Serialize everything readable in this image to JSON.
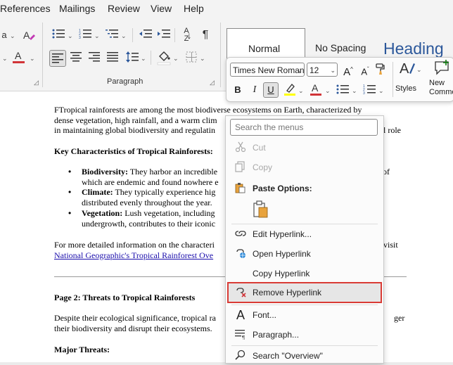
{
  "tabs": [
    "References",
    "Mailings",
    "Review",
    "View",
    "Help"
  ],
  "ribbon": {
    "paragraph_label": "Paragraph",
    "styles": [
      "Normal",
      "No Spacing",
      "Heading"
    ]
  },
  "mini_toolbar": {
    "font_name": "Times New Roman",
    "font_size": "12",
    "styles_label": "Styles",
    "new_comment_label": "New Comment",
    "bold": "B",
    "italic": "I",
    "underline": "U",
    "grow_font": "A",
    "shrink_font": "A"
  },
  "document": {
    "intro": [
      "FTropical rainforests are among the most biodiverse ecosystems on Earth, characterized by",
      "dense vegetation, high rainfall, and a warm clim",
      "in maintaining global biodiversity and regulatin"
    ],
    "intro_tail_1": "l role",
    "key_heading": "Key Characteristics of Tropical Rainforests:",
    "bullets": [
      {
        "title": "Biodiversity:",
        "line1": "They harbor an incredible",
        "line2": "which are endemic and found nowhere e",
        "tail": "of"
      },
      {
        "title": "Climate:",
        "line1": "They typically experience hig",
        "line2": "distributed evenly throughout the year.",
        "tail": ""
      },
      {
        "title": "Vegetation:",
        "line1": "Lush vegetation, including",
        "line2": "undergrowth, contributes to their iconic",
        "tail": ""
      }
    ],
    "more_info": "For more detailed information on the characteri",
    "more_info_tail": "visit",
    "link_text": "National Geographic's Tropical Rainforest Ove",
    "page2_heading": "Page 2: Threats to Tropical Rainforests",
    "despite": [
      "Despite their ecological significance, tropical ra",
      "their biodiversity and disrupt their ecosystems."
    ],
    "despite_tail": "ger",
    "major_threats": "Major Threats:"
  },
  "context_menu": {
    "search_placeholder": "Search the menus",
    "cut": "Cut",
    "copy": "Copy",
    "paste_options": "Paste Options:",
    "edit_hyperlink": "Edit Hyperlink...",
    "open_hyperlink": "Open Hyperlink",
    "copy_hyperlink": "Copy Hyperlink",
    "remove_hyperlink": "Remove Hyperlink",
    "font": "Font...",
    "paragraph": "Paragraph...",
    "search_overview": "Search \"Overview\""
  },
  "colors": {
    "font_color_bar": "#d13438",
    "highlight_bar": "#ffff00",
    "link": "#1a0dab",
    "selection_box": "#d93b35"
  }
}
